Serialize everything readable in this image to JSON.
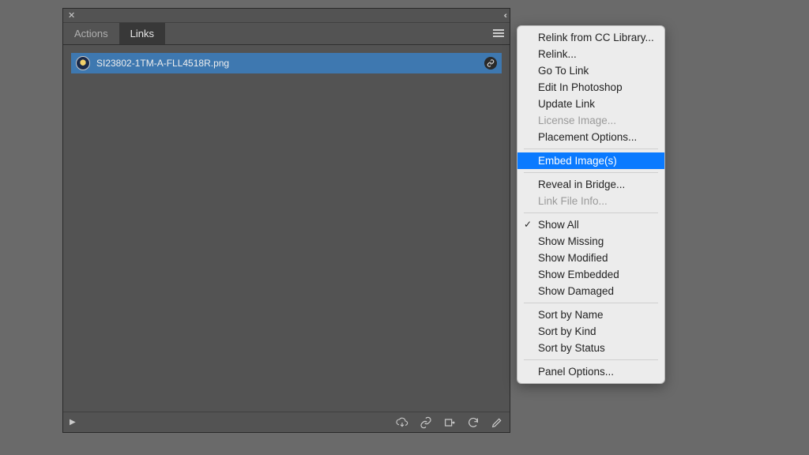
{
  "panel": {
    "tabs": [
      {
        "label": "Actions",
        "active": false
      },
      {
        "label": "Links",
        "active": true
      }
    ],
    "link": {
      "filename": "SI23802-1TM-A-FLL4518R.png"
    }
  },
  "menu": {
    "groups": [
      [
        {
          "label": "Relink from CC Library...",
          "enabled": true
        },
        {
          "label": "Relink...",
          "enabled": true
        },
        {
          "label": "Go To Link",
          "enabled": true
        },
        {
          "label": "Edit In Photoshop",
          "enabled": true
        },
        {
          "label": "Update Link",
          "enabled": true
        },
        {
          "label": "License Image...",
          "enabled": false
        },
        {
          "label": "Placement Options...",
          "enabled": true
        }
      ],
      [
        {
          "label": "Embed Image(s)",
          "enabled": true,
          "selected": true
        }
      ],
      [
        {
          "label": "Reveal in Bridge...",
          "enabled": true
        },
        {
          "label": "Link File Info...",
          "enabled": false
        }
      ],
      [
        {
          "label": "Show All",
          "enabled": true,
          "checked": true
        },
        {
          "label": "Show Missing",
          "enabled": true
        },
        {
          "label": "Show Modified",
          "enabled": true
        },
        {
          "label": "Show Embedded",
          "enabled": true
        },
        {
          "label": "Show Damaged",
          "enabled": true
        }
      ],
      [
        {
          "label": "Sort by Name",
          "enabled": true
        },
        {
          "label": "Sort by Kind",
          "enabled": true
        },
        {
          "label": "Sort by Status",
          "enabled": true
        }
      ],
      [
        {
          "label": "Panel Options...",
          "enabled": true
        }
      ]
    ]
  }
}
